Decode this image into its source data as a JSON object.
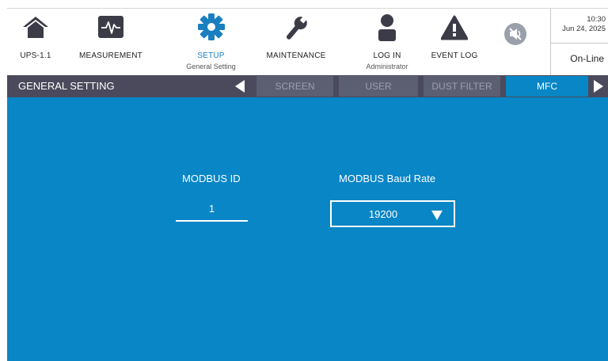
{
  "nav": {
    "ups": {
      "label": "UPS-1.1",
      "icon": "home-icon"
    },
    "measurement": {
      "label": "MEASUREMENT",
      "icon": "waveform-icon"
    },
    "setup": {
      "label": "SETUP",
      "sub": "General Setting",
      "icon": "gear-icon"
    },
    "maintenance": {
      "label": "MAINTENANCE",
      "icon": "wrench-icon"
    },
    "login": {
      "label": "LOG IN",
      "sub": "Administrator",
      "icon": "user-icon"
    },
    "eventlog": {
      "label": "EVENT LOG",
      "icon": "warning-icon"
    },
    "mute": {
      "icon": "speaker-muted-icon"
    }
  },
  "status": {
    "time": "10:30",
    "date": "Jun 24, 2025",
    "mode": "On-Line"
  },
  "subnav": {
    "title": "GENERAL SETTING",
    "tabs": [
      "SCREEN",
      "USER",
      "DUST FILTER",
      "MFC"
    ],
    "active_tab": "MFC"
  },
  "form": {
    "modbus_id": {
      "label": "MODBUS ID",
      "value": "1"
    },
    "baud_rate": {
      "label": "MODBUS Baud Rate",
      "value": "19200"
    }
  },
  "colors": {
    "accent": "#0886c6",
    "subbar": "#4a4a5c",
    "active_nav": "#1a7fc0"
  }
}
